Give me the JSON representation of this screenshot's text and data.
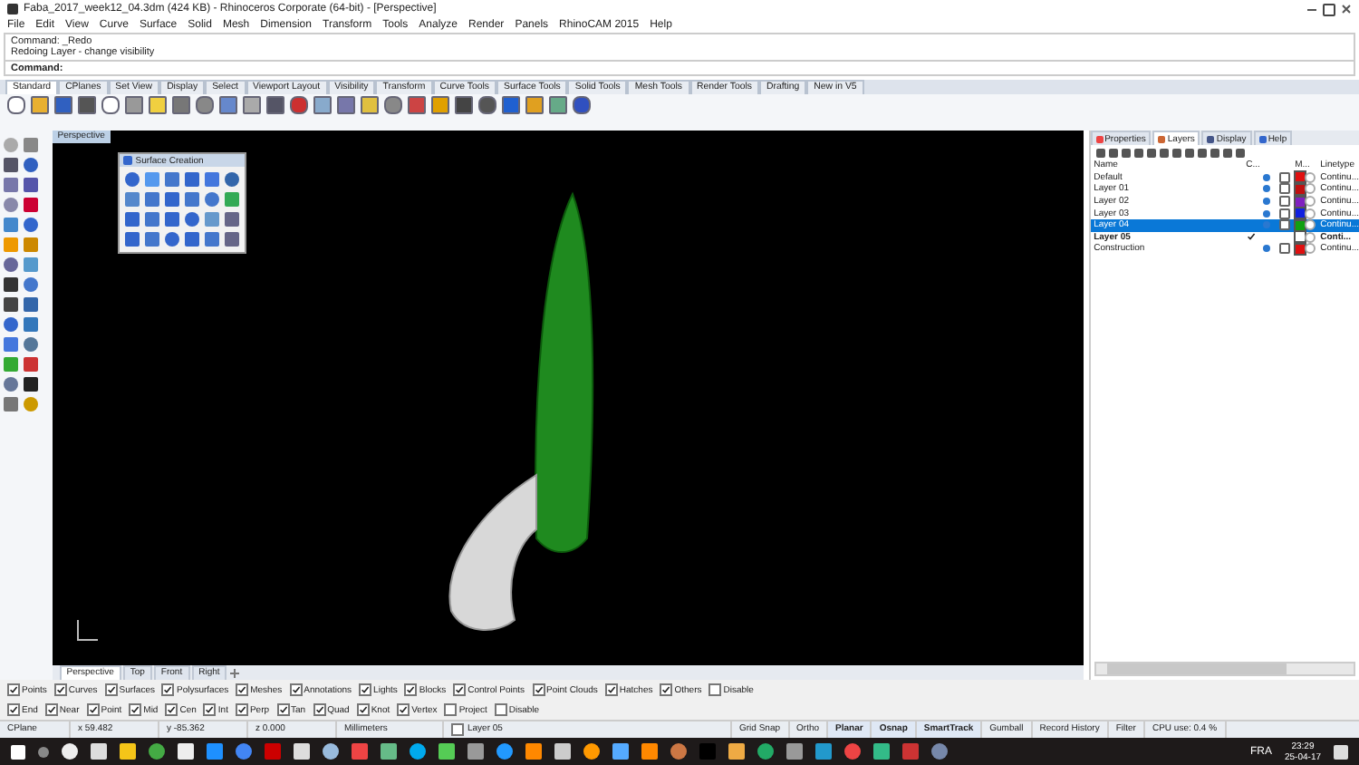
{
  "window": {
    "title": "Faba_2017_week12_04.3dm (424 KB) - Rhinoceros Corporate (64-bit) - [Perspective]"
  },
  "menu": [
    "File",
    "Edit",
    "View",
    "Curve",
    "Surface",
    "Solid",
    "Mesh",
    "Dimension",
    "Transform",
    "Tools",
    "Analyze",
    "Render",
    "Panels",
    "RhinoCAM 2015",
    "Help"
  ],
  "command_history": [
    "Command: _Redo",
    "Redoing Layer - change visibility"
  ],
  "command_prompt": "Command:",
  "toolbar_tabs": [
    {
      "label": "Standard",
      "selected": true
    },
    {
      "label": "CPlanes",
      "selected": false
    },
    {
      "label": "Set View",
      "selected": false
    },
    {
      "label": "Display",
      "selected": false
    },
    {
      "label": "Select",
      "selected": false
    },
    {
      "label": "Viewport Layout",
      "selected": false
    },
    {
      "label": "Visibility",
      "selected": false
    },
    {
      "label": "Transform",
      "selected": false
    },
    {
      "label": "Curve Tools",
      "selected": false
    },
    {
      "label": "Surface Tools",
      "selected": false
    },
    {
      "label": "Solid Tools",
      "selected": false
    },
    {
      "label": "Mesh Tools",
      "selected": false
    },
    {
      "label": "Render Tools",
      "selected": false
    },
    {
      "label": "Drafting",
      "selected": false
    },
    {
      "label": "New in V5",
      "selected": false
    }
  ],
  "viewport": {
    "title": "Perspective",
    "floating_toolbar": {
      "title": "Surface Creation"
    }
  },
  "viewport_tabs": [
    {
      "label": "Perspective",
      "selected": true
    },
    {
      "label": "Top",
      "selected": false
    },
    {
      "label": "Front",
      "selected": false
    },
    {
      "label": "Right",
      "selected": false
    }
  ],
  "panel": {
    "tabs": [
      {
        "label": "Properties",
        "selected": false
      },
      {
        "label": "Layers",
        "selected": true
      },
      {
        "label": "Display",
        "selected": false
      },
      {
        "label": "Help",
        "selected": false
      }
    ],
    "columns": [
      "Name",
      "C...",
      "M...",
      "Linetype"
    ],
    "layers": [
      {
        "name": "Default",
        "selected": false,
        "current": false,
        "color": "#e01010",
        "linetype": "Continu..."
      },
      {
        "name": "Layer 01",
        "selected": false,
        "current": false,
        "color": "#c01010",
        "linetype": "Continu..."
      },
      {
        "name": "Layer 02",
        "selected": false,
        "current": false,
        "color": "#8020c0",
        "linetype": "Continu..."
      },
      {
        "name": "Layer 03",
        "selected": false,
        "current": false,
        "color": "#1020e0",
        "linetype": "Continu..."
      },
      {
        "name": "Layer 04",
        "selected": true,
        "current": false,
        "color": "#10a010",
        "linetype": "Continu..."
      },
      {
        "name": "Layer 05",
        "selected": false,
        "current": true,
        "color": "#ffffff",
        "linetype": "Conti..."
      },
      {
        "name": "Construction",
        "selected": false,
        "current": false,
        "color": "#e01010",
        "linetype": "Continu..."
      }
    ]
  },
  "filters": [
    {
      "label": "Points",
      "checked": true
    },
    {
      "label": "Curves",
      "checked": true
    },
    {
      "label": "Surfaces",
      "checked": true
    },
    {
      "label": "Polysurfaces",
      "checked": true
    },
    {
      "label": "Meshes",
      "checked": true
    },
    {
      "label": "Annotations",
      "checked": true
    },
    {
      "label": "Lights",
      "checked": true
    },
    {
      "label": "Blocks",
      "checked": true
    },
    {
      "label": "Control Points",
      "checked": true
    },
    {
      "label": "Point Clouds",
      "checked": true
    },
    {
      "label": "Hatches",
      "checked": true
    },
    {
      "label": "Others",
      "checked": true
    },
    {
      "label": "Disable",
      "checked": false
    }
  ],
  "osnaps": [
    {
      "label": "End",
      "checked": true
    },
    {
      "label": "Near",
      "checked": true
    },
    {
      "label": "Point",
      "checked": true
    },
    {
      "label": "Mid",
      "checked": true
    },
    {
      "label": "Cen",
      "checked": true
    },
    {
      "label": "Int",
      "checked": true
    },
    {
      "label": "Perp",
      "checked": true
    },
    {
      "label": "Tan",
      "checked": true
    },
    {
      "label": "Quad",
      "checked": true
    },
    {
      "label": "Knot",
      "checked": true
    },
    {
      "label": "Vertex",
      "checked": true
    },
    {
      "label": "Project",
      "checked": false
    },
    {
      "label": "Disable",
      "checked": false
    }
  ],
  "status_bar": {
    "cplane": "CPlane",
    "x": "x 59.482",
    "y": "y -85.362",
    "z": "z 0.000",
    "units": "Millimeters",
    "layer": "Layer 05",
    "toggles": [
      {
        "label": "Grid Snap",
        "on": false
      },
      {
        "label": "Ortho",
        "on": false
      },
      {
        "label": "Planar",
        "on": true
      },
      {
        "label": "Osnap",
        "on": true
      },
      {
        "label": "SmartTrack",
        "on": true
      },
      {
        "label": "Gumball",
        "on": false
      },
      {
        "label": "Record History",
        "on": false
      },
      {
        "label": "Filter",
        "on": false
      }
    ],
    "cpu": "CPU use: 0.4 %"
  },
  "taskbar": {
    "language": "FRA",
    "time": "23:29",
    "date": "25-04-17"
  }
}
